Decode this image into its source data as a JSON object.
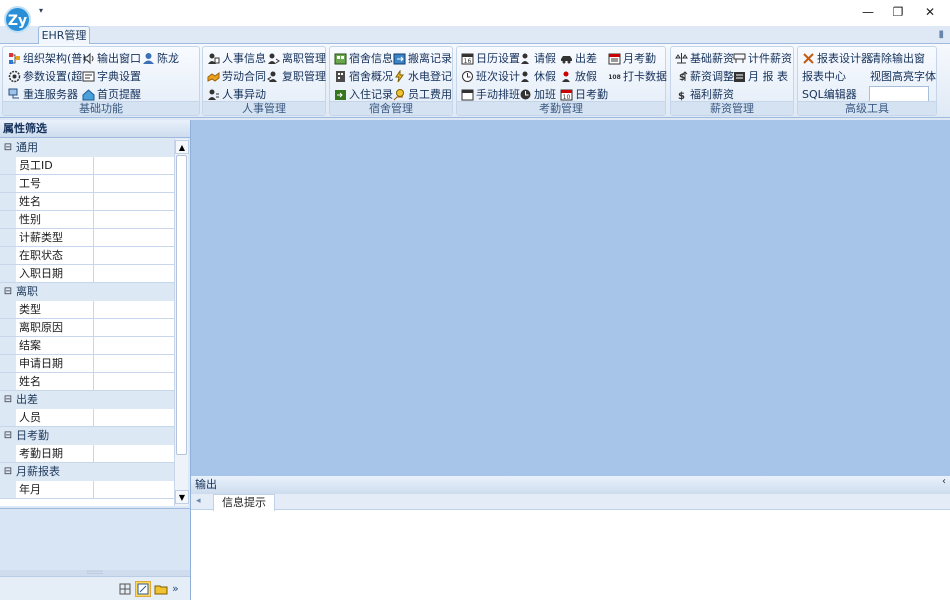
{
  "app": {
    "logo_text": "Zy",
    "qat_arrow": "▾"
  },
  "window": {
    "min": "—",
    "restore": "❐",
    "close": "✕"
  },
  "tabs": [
    {
      "label": "EHR管理"
    }
  ],
  "pin": "▮",
  "ribbon": {
    "groups": [
      {
        "label": "基础功能",
        "items": [
          "组织架构(普)",
          "输出窗口",
          "陈龙",
          "参数设置(超)",
          "字典设置",
          "重连服务器",
          "首页提醒"
        ]
      },
      {
        "label": "人事管理",
        "items": [
          "人事信息",
          "离职管理",
          "劳动合同",
          "复职管理",
          "人事异动"
        ]
      },
      {
        "label": "宿舍管理",
        "items": [
          "宿舍信息",
          "搬离记录",
          "宿舍概况",
          "水电登记",
          "入住记录",
          "员工费用"
        ]
      },
      {
        "label": "考勤管理",
        "items": [
          "日历设置",
          "请假",
          "出差",
          "月考勤",
          "班次设计",
          "休假",
          "放假",
          "打卡数据",
          "手动排班",
          "加班",
          "日考勤"
        ]
      },
      {
        "label": "薪资管理",
        "items": [
          "基础薪资",
          "计件薪资",
          "薪资调整",
          "月 报 表",
          "福利薪资"
        ]
      },
      {
        "label": "高级工具",
        "items": [
          "报表设计器",
          "清除输出窗",
          "报表中心",
          "视图高亮字体",
          "SQL编辑器"
        ]
      }
    ],
    "sql_value": ""
  },
  "left_panel": {
    "title": "属性筛选",
    "categories": [
      {
        "name": "通用",
        "toggle": "⊟",
        "rows": [
          "员工ID",
          "工号",
          "姓名",
          "性别",
          "计薪类型",
          "在职状态",
          "入职日期"
        ]
      },
      {
        "name": "离职",
        "toggle": "⊟",
        "rows": [
          "类型",
          "离职原因",
          "结案",
          "申请日期",
          "姓名"
        ]
      },
      {
        "name": "出差",
        "toggle": "⊟",
        "rows": [
          "人员"
        ]
      },
      {
        "name": "日考勤",
        "toggle": "⊟",
        "rows": [
          "考勤日期"
        ]
      },
      {
        "name": "月薪报表",
        "toggle": "⊟",
        "rows": [
          "年月"
        ]
      }
    ],
    "scroll_up": "▲",
    "scroll_down": "▼",
    "splitter": "::::::::",
    "more": "»"
  },
  "output": {
    "title": "输出",
    "close": "‹",
    "left_arrow": "◂",
    "tab": "信息提示"
  },
  "colors": {
    "workspace": "#a7c5e8",
    "accent": "#2b8fd8"
  }
}
